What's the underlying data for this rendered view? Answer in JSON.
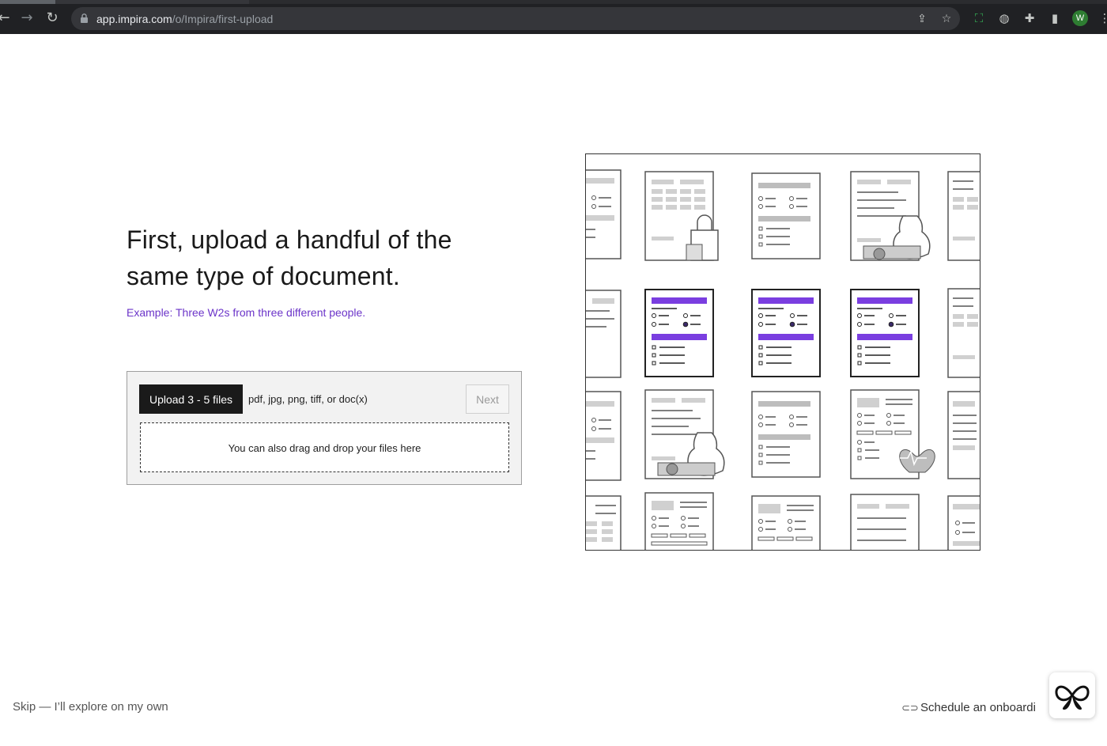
{
  "browser": {
    "url_host": "app.impira.com",
    "url_path": "/o/Impira/first-upload",
    "back_icon": "back-arrow-icon",
    "forward_icon": "forward-arrow-icon",
    "reload_icon": "reload-icon",
    "avatar_letter": "W"
  },
  "main": {
    "headline": "First, upload a handful of the same type of document.",
    "example": "Example: Three W2s from three different people.",
    "upload": {
      "button_label": "Upload 3 - 5 files",
      "formats": "pdf, jpg, png, tiff, or doc(x)",
      "next_label": "Next",
      "dropzone_text": "You can also drag and drop your files here"
    }
  },
  "footer": {
    "skip_label": "Skip — I’ll explore on my own",
    "schedule_label": "Schedule an onboardi"
  },
  "colors": {
    "accent": "#6c35c9",
    "button_dark": "#1a1a1a"
  }
}
